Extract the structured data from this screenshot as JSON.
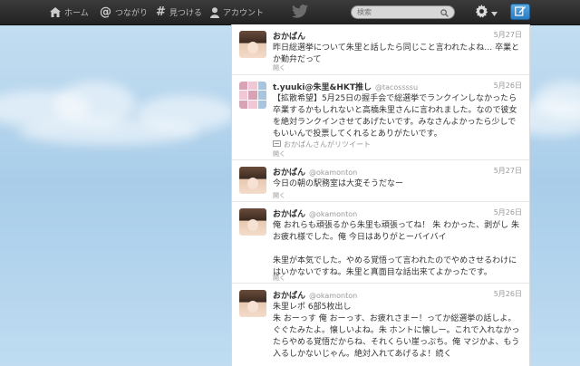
{
  "nav": {
    "home": "ホーム",
    "connect": "つながり",
    "discover": "見つける",
    "account": "アカウント"
  },
  "search": {
    "placeholder": "検索"
  },
  "colors": {
    "topbar": "#2b2b2b",
    "link_blue": "#2b7bc0"
  },
  "icons": [
    "home-icon",
    "at-icon",
    "hash-icon",
    "person-icon",
    "twitter-bird-icon",
    "search-icon",
    "gear-icon",
    "compose-icon"
  ],
  "tweets": [
    {
      "name": "おかぱん",
      "handle": "",
      "date": "5月27日",
      "text": "昨日総選挙について朱里と話したら同じこと言われたよね… 卒業とか勤弁だって",
      "retweet": "",
      "open": "開く"
    },
    {
      "name": "t.yuuki@朱里&HKT推し",
      "handle": "@tacossssu",
      "date": "5月26日",
      "text": "【拡散希望】5月25日の握手会で総選挙でランクインしなかったら卒業するかもしれないと高橋朱里さんに言われました。なので彼女を絶対ランクインさせてあげたいです。みなさんよかったら少しでもいいんで投票してくれるとありがたいです。",
      "retweet": "おかぱんさんがリツイート",
      "open": "開く"
    },
    {
      "name": "おかぱん",
      "handle": "@okamonton",
      "date": "5月27日",
      "text": "今日の朝の駅務室は大変そうだなー",
      "retweet": "",
      "open": "開く"
    },
    {
      "name": "おかぱん",
      "handle": "@okamonton",
      "date": "5月26日",
      "text": "俺 おれらも頑張るから朱里も頑張ってね！ 朱 わかった、剥がし 朱 お疲れ様でした。俺 今日はありがとーバイバイ\n\n朱里が本気でした。やめる覚悟って言われたのでやめさせるわけにはいかないですね。朱里と真面目な話出来てよかったです。",
      "retweet": "",
      "open": "開く"
    },
    {
      "name": "おかぱん",
      "handle": "@okamonton",
      "date": "5月26日",
      "text": "朱里レポ 6部5枚出し\n朱 おーっす 俺 おーっす、お疲れさまー！ってか総選挙の話しよ。ぐぐたみたよ。懐しいよね。朱 ホントに懐しー。これで入れなかったらやめる覚悟だからね、それくらい崖っぷち。俺 マジかよ、もう入るしかないじゃん。絶対入れてあげるよ！続く",
      "retweet": "",
      "open": ""
    }
  ]
}
